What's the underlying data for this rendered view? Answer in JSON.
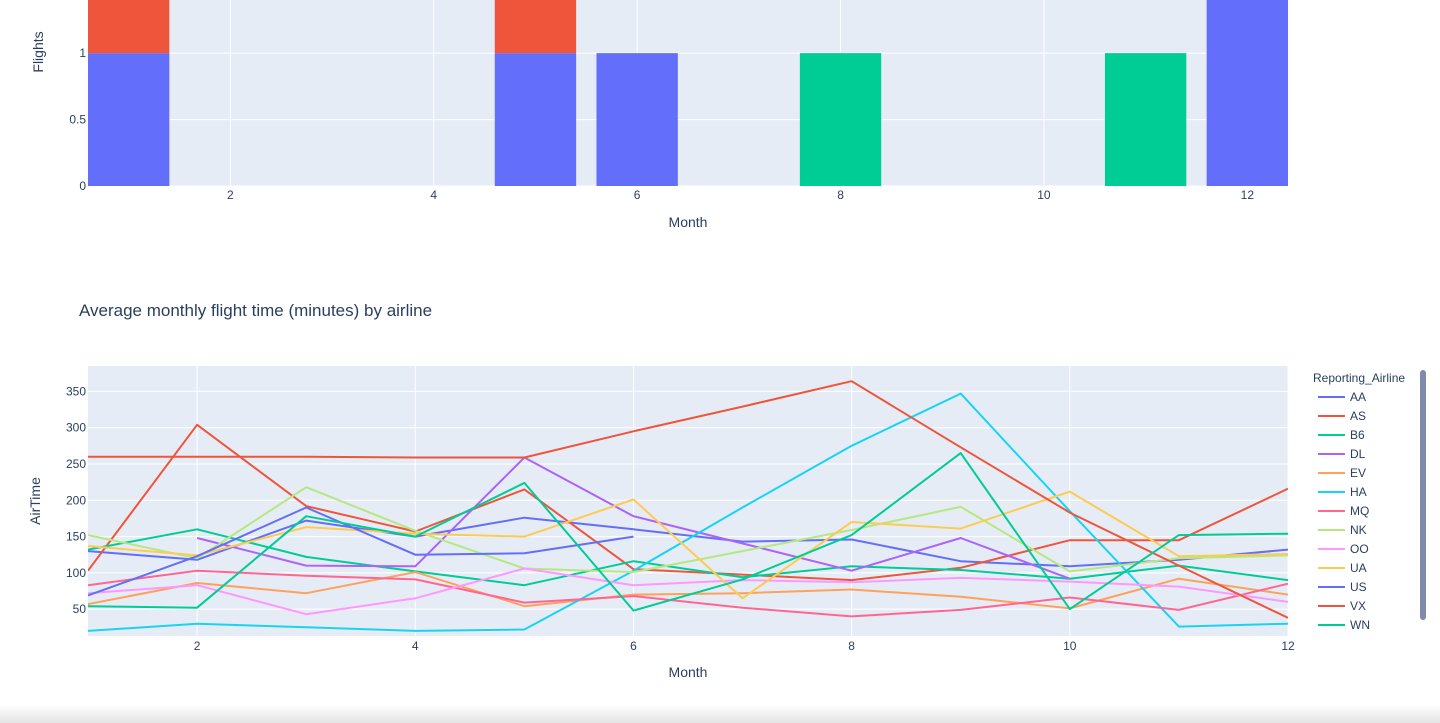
{
  "chart_data": [
    {
      "type": "bar",
      "barmode": "stack",
      "title": "",
      "xlabel": "Month",
      "ylabel": "Flights",
      "xlim": [
        0.6,
        12.4
      ],
      "ylim": [
        0,
        1.4
      ],
      "x_ticks": [
        2,
        4,
        6,
        8,
        10,
        12
      ],
      "y_ticks": [
        0,
        0.5,
        1
      ],
      "grid": true,
      "series": [
        {
          "color": "#636efa",
          "points": [
            {
              "x": 1,
              "y": 1
            },
            {
              "x": 5,
              "y": 1
            },
            {
              "x": 6,
              "y": 1
            },
            {
              "x": 12,
              "y": 1.4
            }
          ]
        },
        {
          "color": "#EF553B",
          "points": [
            {
              "x": 1,
              "y": 0.4
            },
            {
              "x": 5,
              "y": 0.4
            }
          ]
        },
        {
          "color": "#00cc96",
          "points": [
            {
              "x": 8,
              "y": 1
            },
            {
              "x": 11,
              "y": 1
            }
          ]
        }
      ]
    },
    {
      "type": "line",
      "title": "Average monthly flight time (minutes) by airline",
      "xlabel": "Month",
      "ylabel": "AirTime",
      "xlim": [
        1,
        12
      ],
      "ylim": [
        13,
        385
      ],
      "x_ticks": [
        2,
        4,
        6,
        8,
        10,
        12
      ],
      "y_ticks": [
        50,
        100,
        150,
        200,
        250,
        300,
        350
      ],
      "grid": true,
      "legend": {
        "title": "Reporting_Airline",
        "position": "right"
      },
      "series": [
        {
          "name": "AA",
          "color": "#636efa",
          "x": [
            1,
            2,
            3,
            4,
            5,
            6,
            7,
            8,
            9,
            10,
            11,
            12
          ],
          "y": [
            130,
            118,
            172,
            150,
            176,
            160,
            143,
            146,
            116,
            109,
            118,
            132
          ]
        },
        {
          "name": "AS",
          "color": "#EF553B",
          "x": [
            1,
            2,
            3,
            4,
            5,
            6,
            8,
            9,
            10,
            11,
            12
          ],
          "y": [
            103,
            304,
            192,
            157,
            215,
            105,
            90,
            107,
            145,
            145,
            216
          ]
        },
        {
          "name": "B6",
          "color": "#00cc96",
          "x": [
            1,
            2,
            3,
            4,
            5,
            6,
            7,
            8,
            9,
            10,
            11,
            12
          ],
          "y": [
            132,
            160,
            122,
            102,
            83,
            116,
            94,
            109,
            104,
            92,
            110,
            90
          ]
        },
        {
          "name": "DL",
          "color": "#ab63fa",
          "x": [
            2,
            3,
            4,
            5,
            6,
            8,
            9,
            10
          ],
          "y": [
            148,
            110,
            109,
            259,
            178,
            103,
            148,
            92
          ]
        },
        {
          "name": "EV",
          "color": "#FFA15A",
          "x": [
            1,
            2,
            3,
            4,
            5,
            6,
            7,
            8,
            9,
            10,
            11,
            12
          ],
          "y": [
            57,
            86,
            72,
            101,
            54,
            70,
            72,
            77,
            67,
            51,
            92,
            70
          ]
        },
        {
          "name": "HA",
          "color": "#19d3f3",
          "x": [
            1,
            2,
            3,
            4,
            5,
            6,
            7,
            8,
            9,
            10,
            11,
            12
          ],
          "y": [
            20,
            30,
            25,
            20,
            22,
            103,
            190,
            275,
            347,
            185,
            26,
            30
          ]
        },
        {
          "name": "MQ",
          "color": "#FF6692",
          "x": [
            1,
            2,
            3,
            4,
            5,
            6,
            7,
            8,
            9,
            10,
            11,
            12
          ],
          "y": [
            83,
            103,
            96,
            91,
            59,
            68,
            52,
            40,
            49,
            66,
            49,
            85
          ]
        },
        {
          "name": "NK",
          "color": "#B6E880",
          "x": [
            1,
            2,
            3,
            4,
            5,
            6,
            7,
            8,
            9,
            10,
            11,
            12
          ],
          "y": [
            152,
            120,
            218,
            158,
            106,
            101,
            130,
            159,
            191,
            102,
            120,
            124
          ]
        },
        {
          "name": "OO",
          "color": "#FF97FF",
          "x": [
            1,
            2,
            3,
            4,
            5,
            6,
            7,
            8,
            9,
            10,
            11,
            12
          ],
          "y": [
            72,
            83,
            43,
            65,
            106,
            83,
            90,
            87,
            93,
            88,
            81,
            60
          ]
        },
        {
          "name": "UA",
          "color": "#FECB52",
          "x": [
            1,
            2,
            3,
            4,
            5,
            6,
            7,
            8,
            9,
            10,
            11,
            12
          ],
          "y": [
            137,
            124,
            163,
            154,
            150,
            201,
            65,
            170,
            161,
            212,
            123,
            126
          ]
        },
        {
          "name": "US",
          "color": "#636efa",
          "x": [
            1,
            2,
            3,
            4,
            5,
            6
          ],
          "y": [
            69,
            123,
            190,
            125,
            127,
            150
          ]
        },
        {
          "name": "VX",
          "color": "#EF553B",
          "x": [
            1,
            2,
            3,
            4,
            5,
            6,
            7,
            8,
            9,
            10,
            11,
            12
          ],
          "y": [
            260,
            260,
            260,
            259,
            259,
            295,
            329,
            364,
            273,
            183,
            110,
            38
          ]
        },
        {
          "name": "WN",
          "color": "#00cc96",
          "x": [
            1,
            2,
            3,
            4,
            5,
            6,
            7,
            8,
            9,
            10,
            11,
            12
          ],
          "y": [
            54,
            52,
            178,
            150,
            224,
            48,
            91,
            152,
            265,
            50,
            152,
            154
          ]
        }
      ]
    }
  ]
}
